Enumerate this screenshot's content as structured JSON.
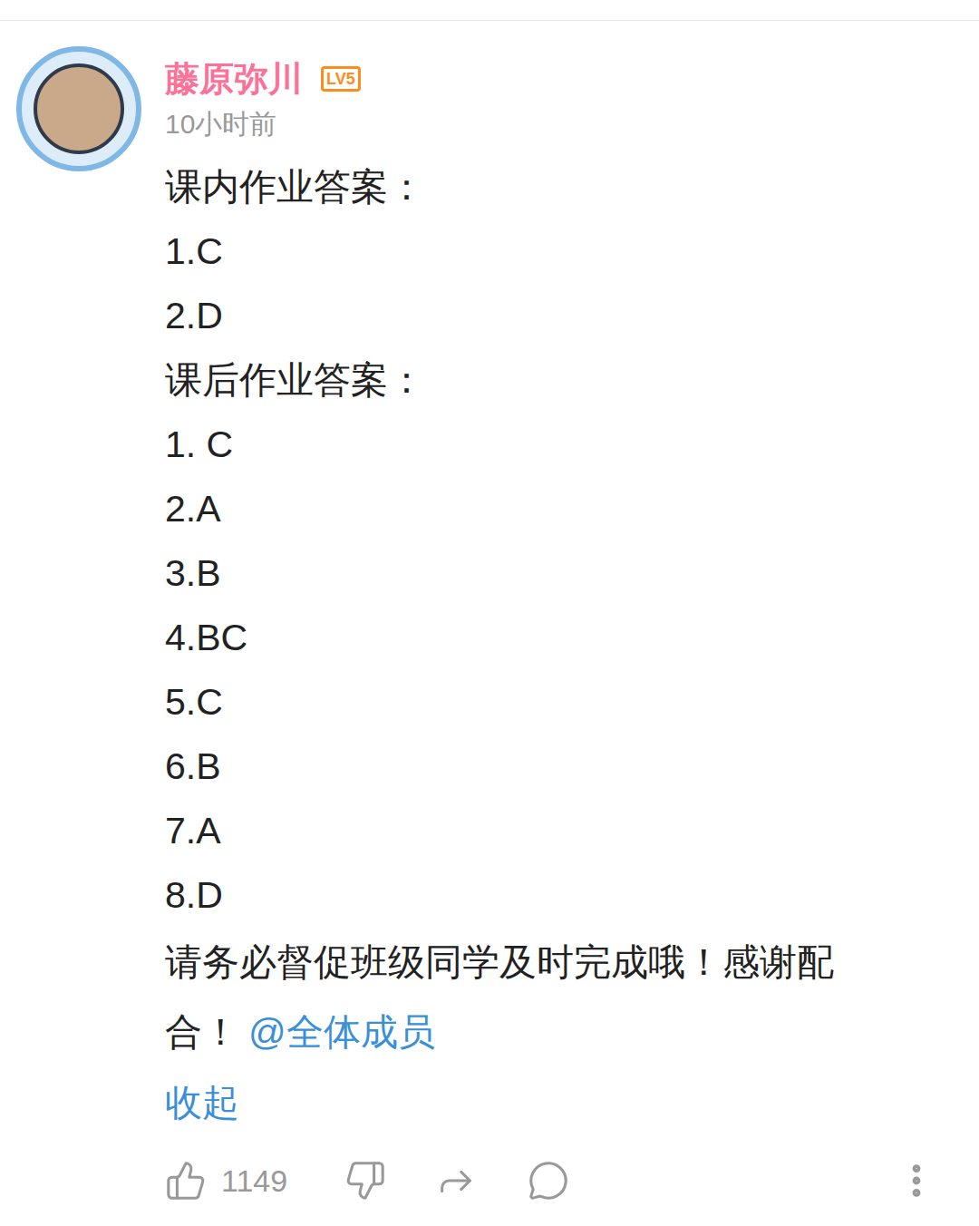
{
  "comment": {
    "username": "藤原弥川",
    "level": "LV5",
    "time": "10小时前",
    "lines": [
      "课内作业答案：",
      "1.C",
      "2.D",
      "课后作业答案：",
      "1. C",
      "2.A",
      "3.B",
      "4.BC",
      "5.C",
      "6.B",
      "7.A",
      "8.D"
    ],
    "notice": "请务必督促班级同学及时完成哦！感谢配合！",
    "mention": "@全体成员",
    "collapse": "收起",
    "likes": "1149"
  }
}
